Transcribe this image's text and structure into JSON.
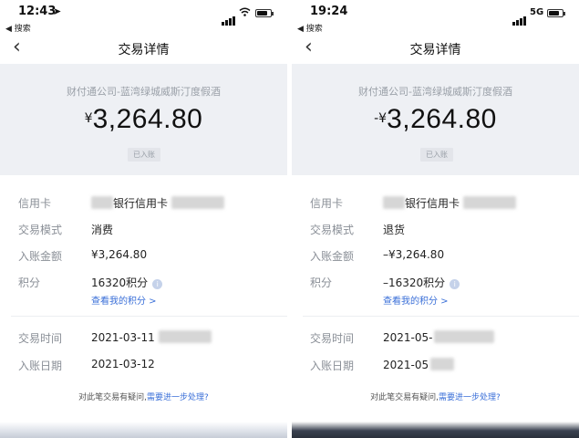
{
  "left": {
    "status": {
      "time": "12:43",
      "back_app": "◀ 搜索"
    },
    "nav": {
      "back": "‹",
      "title": "交易详情"
    },
    "hero": {
      "merchant": "财付通公司-蓝湾绿城威斯汀度假酒",
      "currency": "¥",
      "amount": "3,264.80",
      "badge": "已入账"
    },
    "details": {
      "card_label": "信用卡",
      "card_value": "银行信用卡",
      "mode_label": "交易模式",
      "mode_value": "消费",
      "posted_amount_label": "入账金额",
      "posted_amount_value": "¥3,264.80",
      "points_label": "积分",
      "points_value": "16320积分",
      "points_link": "查看我的积分 >",
      "time_label": "交易时间",
      "time_value": "2021-03-11",
      "date_label": "入账日期",
      "date_value": "2021-03-12"
    },
    "question": {
      "text": "对此笔交易有疑问,",
      "link": "需要进一步处理?"
    }
  },
  "right": {
    "status": {
      "time": "19:24",
      "back_app": "◀ 搜索",
      "network": "5G"
    },
    "nav": {
      "back": "‹",
      "title": "交易详情"
    },
    "hero": {
      "merchant": "财付通公司-蓝湾绿城威斯汀度假酒",
      "currency": "-¥",
      "amount": "3,264.80",
      "badge": "已入账"
    },
    "details": {
      "card_label": "信用卡",
      "card_value": "银行信用卡",
      "mode_label": "交易模式",
      "mode_value": "退货",
      "posted_amount_label": "入账金额",
      "posted_amount_value": "–¥3,264.80",
      "points_label": "积分",
      "points_value": "–16320积分",
      "points_link": "查看我的积分 >",
      "time_label": "交易时间",
      "time_value": "2021-05-",
      "date_label": "入账日期",
      "date_value": "2021-05"
    },
    "question": {
      "text": "对此笔交易有疑问,",
      "link": "需要进一步处理?"
    }
  },
  "icons": {
    "location": "location-arrow-icon",
    "signal": "signal-bars-icon",
    "wifi": "wifi-icon",
    "battery": "battery-icon",
    "back": "chevron-left-icon",
    "info": "info-icon"
  },
  "colors": {
    "hero_bg": "#eef0f4",
    "link": "#3a6fd8",
    "label": "#8a8f97"
  }
}
